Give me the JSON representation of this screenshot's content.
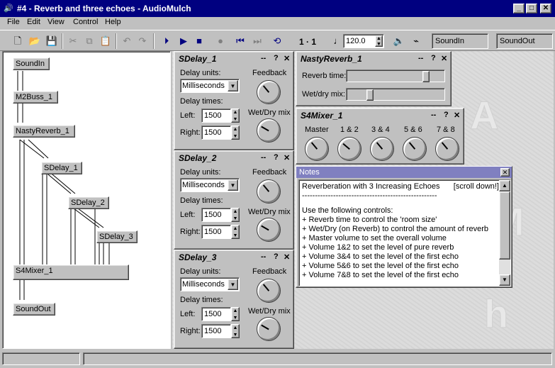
{
  "window": {
    "title": "#4 - Reverb and three echoes - AudioMulch",
    "icon": "speaker-icon",
    "buttons": {
      "min": "_",
      "max": "□",
      "close": "✕"
    }
  },
  "menu": [
    "File",
    "Edit",
    "View",
    "Control",
    "Help"
  ],
  "toolbar": {
    "position": "1 · 1",
    "tempo": "120.0",
    "input": "SoundIn",
    "output": "SoundOut"
  },
  "patcher": {
    "nodes": [
      "SoundIn",
      "M2Buss_1",
      "NastyReverb_1",
      "SDelay_1",
      "SDelay_2",
      "SDelay_3",
      "S4Mixer_1",
      "SoundOut"
    ]
  },
  "delays": [
    {
      "title": "SDelay_1",
      "units_label": "Delay units:",
      "units_value": "Milliseconds",
      "feedback_label": "Feedback",
      "times_label": "Delay times:",
      "left_label": "Left:",
      "left_value": "1500",
      "right_label": "Right:",
      "right_value": "1500",
      "wetdry_label": "Wet/Dry mix"
    },
    {
      "title": "SDelay_2",
      "units_label": "Delay units:",
      "units_value": "Milliseconds",
      "feedback_label": "Feedback",
      "times_label": "Delay times:",
      "left_label": "Left:",
      "left_value": "1500",
      "right_label": "Right:",
      "right_value": "1500",
      "wetdry_label": "Wet/Dry mix"
    },
    {
      "title": "SDelay_3",
      "units_label": "Delay units:",
      "units_value": "Milliseconds",
      "feedback_label": "Feedback",
      "times_label": "Delay times:",
      "left_label": "Left:",
      "left_value": "1500",
      "right_label": "Right:",
      "right_value": "1500",
      "wetdry_label": "Wet/Dry mix"
    }
  ],
  "panel_controls": {
    "minimize": "--",
    "help": "?",
    "close": "✕"
  },
  "reverb": {
    "title": "NastyReverb_1",
    "time_label": "Reverb time:",
    "time_level": 0.85,
    "mix_label": "Wet/dry mix:",
    "mix_level": 0.22
  },
  "mixer": {
    "title": "S4Mixer_1",
    "labels": [
      "Master",
      "1 & 2",
      "3 & 4",
      "5 & 6",
      "7 & 8"
    ]
  },
  "notes": {
    "title": "Notes",
    "heading": "Reverberation with 3 Increasing Echoes",
    "scroll_hint": "[scroll down!]",
    "rule": "----------------------------------------------------",
    "lines": [
      "Use the following controls:",
      "+ Reverb time to control the 'room size'",
      "+ Wet/Dry (on Reverb) to control the amount of reverb",
      "+ Master volume to set the overall volume",
      "+ Volume 1&2 to set the level of pure reverb",
      "+ Volume 3&4 to set the level of the first echo",
      "+ Volume 5&6 to set the level of the first echo",
      "+ Volume 7&8 to set the level of the first echo"
    ]
  }
}
